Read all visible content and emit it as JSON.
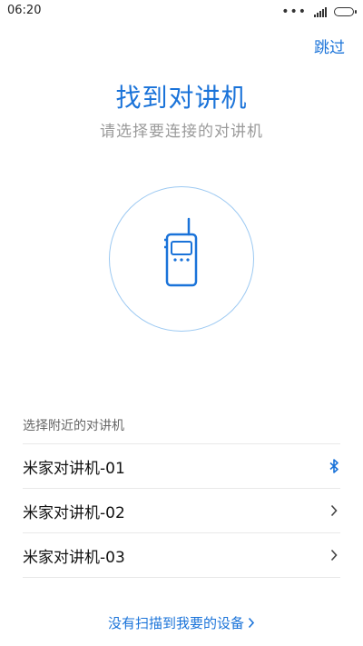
{
  "status_bar": {
    "time": "06:20",
    "icons": [
      "more-dots-icon",
      "signal-icon",
      "battery-icon"
    ]
  },
  "header": {
    "skip_label": "跳过"
  },
  "hero": {
    "title": "找到对讲机",
    "subtitle": "请选择要连接的对讲机",
    "icon": "walkie-talkie-icon"
  },
  "devices": {
    "section_label": "选择附近的对讲机",
    "items": [
      {
        "label": "米家对讲机-01",
        "icon": "bluetooth-icon"
      },
      {
        "label": "米家对讲机-02",
        "icon": "chevron-right-icon"
      },
      {
        "label": "米家对讲机-03",
        "icon": "chevron-right-icon"
      }
    ]
  },
  "footer": {
    "not_found_label": "没有扫描到我要的设备"
  },
  "colors": {
    "accent": "#1a73d9",
    "circle_border": "#9cc9f2",
    "subtitle_text": "#9a9a9a",
    "divider": "#e8e8e8"
  }
}
